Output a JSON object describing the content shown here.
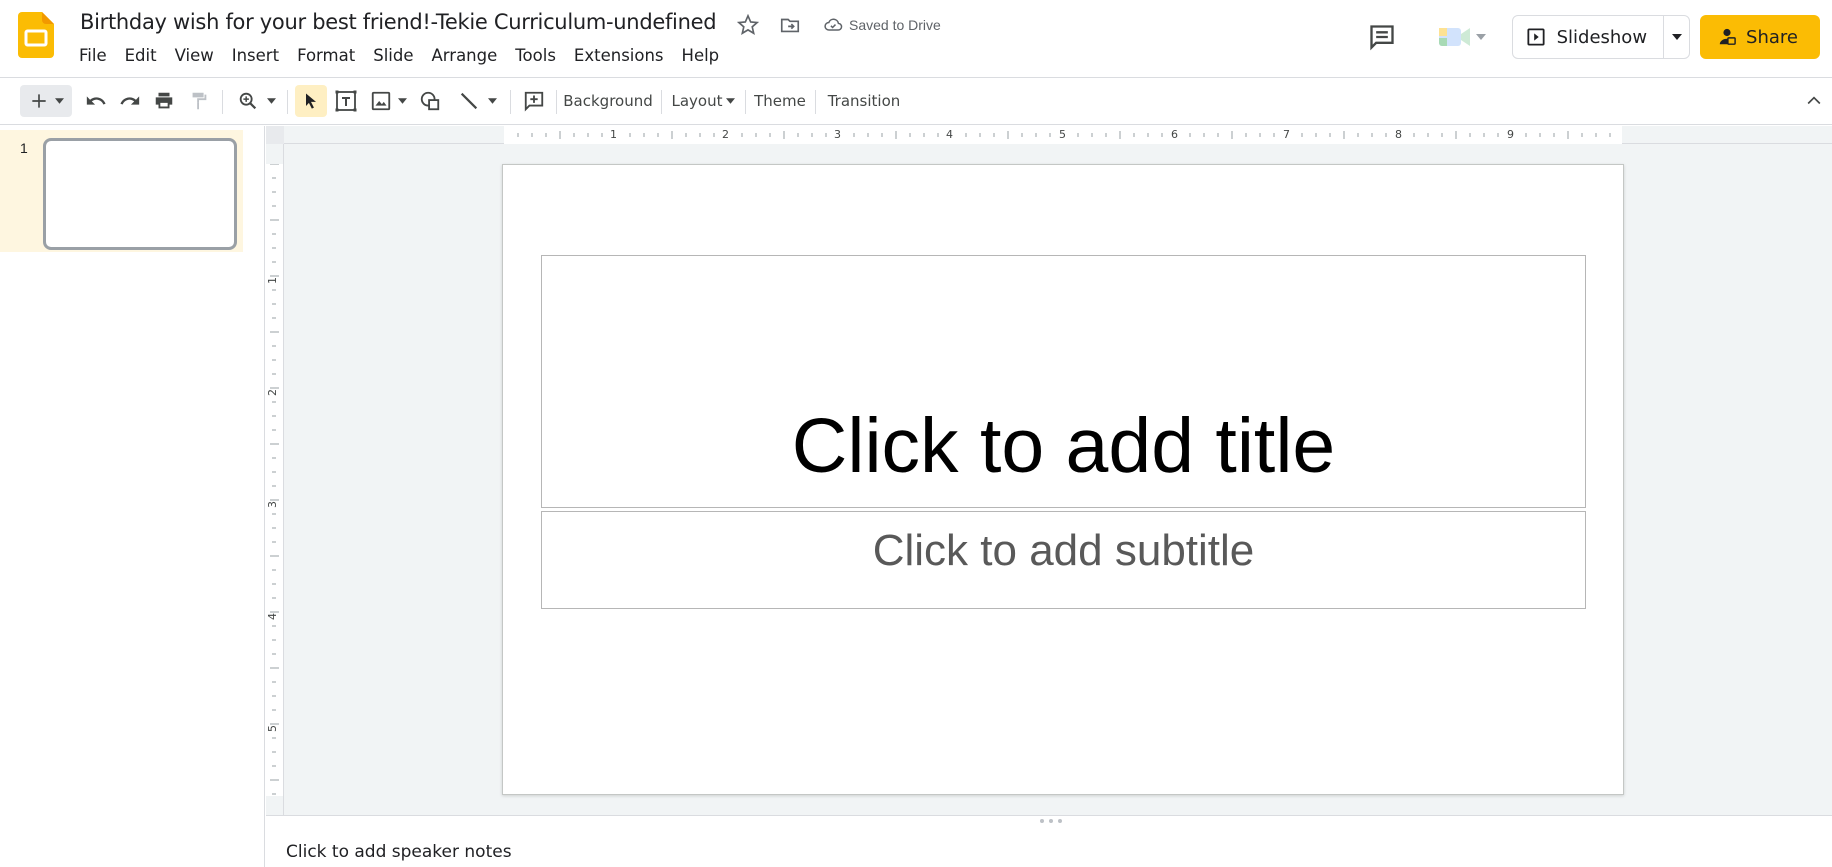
{
  "header": {
    "doc_title": "Birthday wish for your best friend!-Tekie Curriculum-undefined",
    "save_status": "Saved to Drive"
  },
  "menu": [
    "File",
    "Edit",
    "View",
    "Insert",
    "Format",
    "Slide",
    "Arrange",
    "Tools",
    "Extensions",
    "Help"
  ],
  "actions": {
    "slideshow_label": "Slideshow",
    "share_label": "Share"
  },
  "toolbar": {
    "background_label": "Background",
    "layout_label": "Layout",
    "theme_label": "Theme",
    "transition_label": "Transition"
  },
  "filmstrip": {
    "slides": [
      {
        "number": "1"
      }
    ]
  },
  "rulers": {
    "horizontal": [
      "1",
      "2",
      "3",
      "4",
      "5",
      "6",
      "7",
      "8",
      "9"
    ],
    "vertical": [
      "1",
      "2",
      "3",
      "4",
      "5"
    ]
  },
  "slide": {
    "title_placeholder": "Click to add title",
    "subtitle_placeholder": "Click to add subtitle"
  },
  "notes": {
    "placeholder": "Click to add speaker notes"
  },
  "colors": {
    "share_button": "#fbbc04",
    "slides_logo": "#fbbc04",
    "selected_thumb_bg": "#fef6e0",
    "workspace_bg": "#f1f4f5"
  }
}
